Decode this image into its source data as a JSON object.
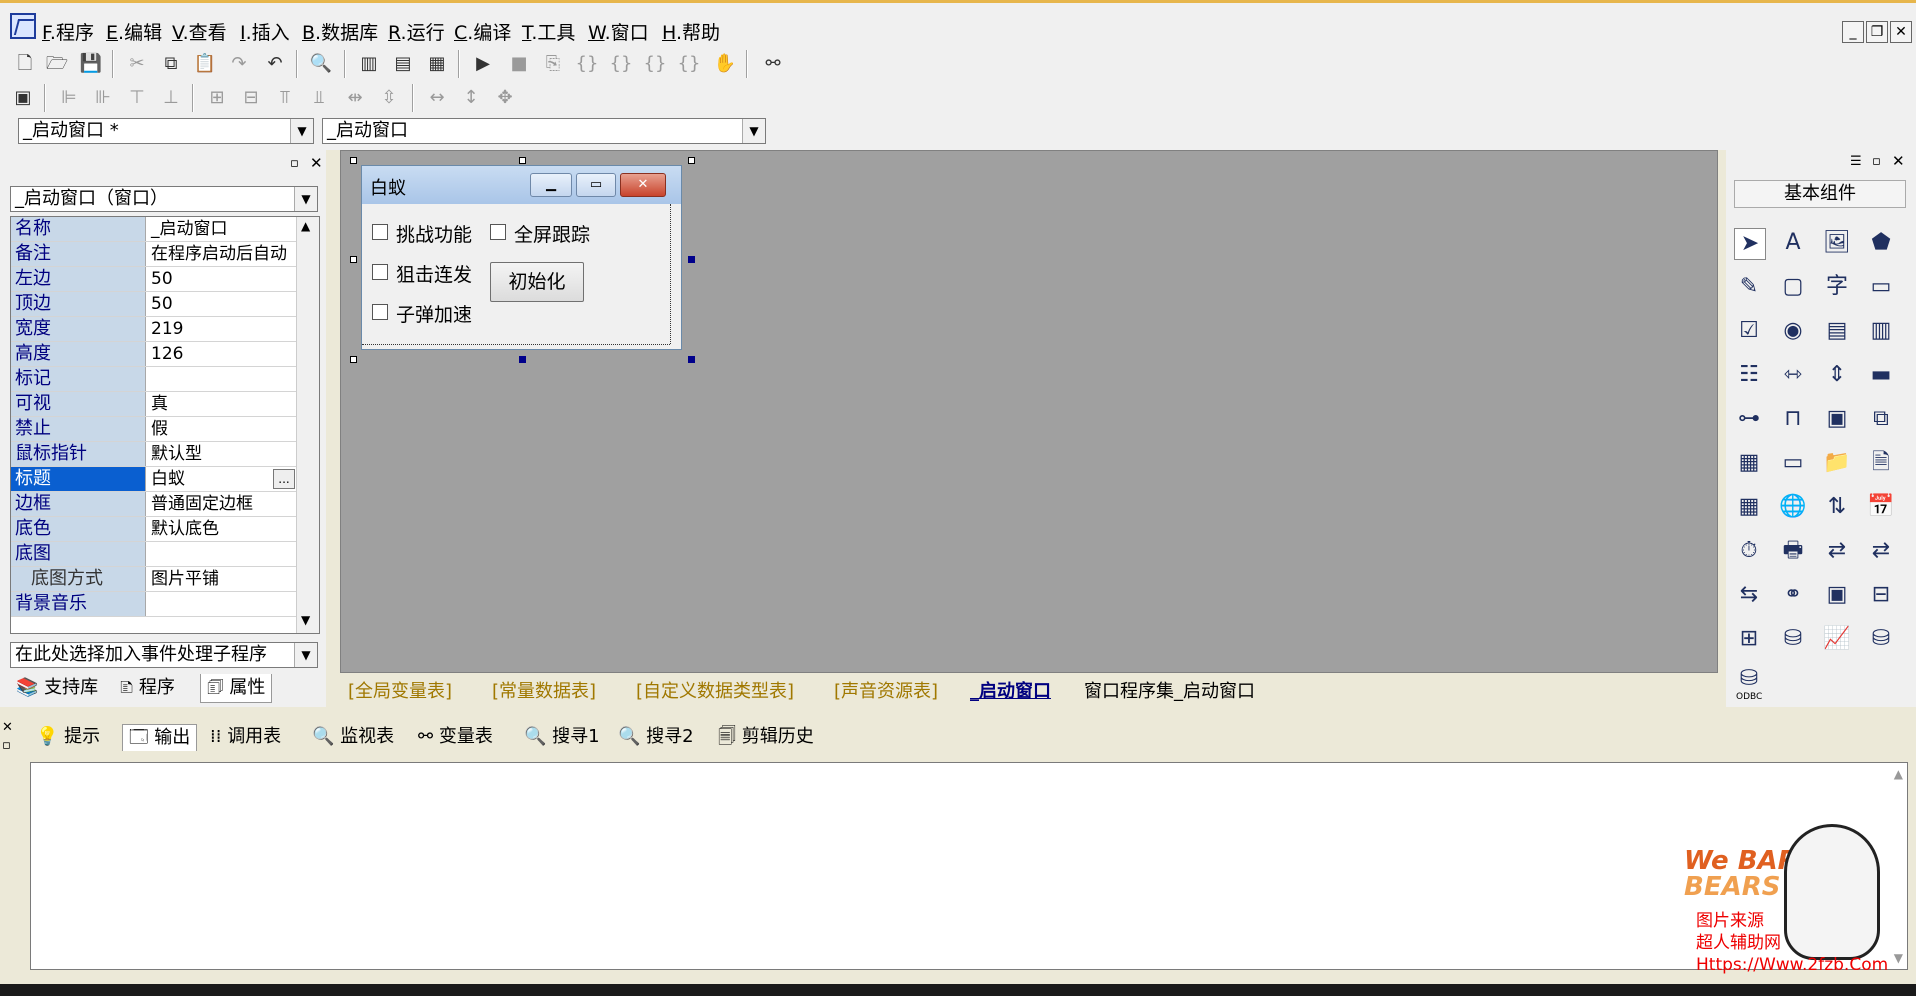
{
  "menu": [
    {
      "key": "F",
      "label": "程序"
    },
    {
      "key": "E",
      "label": "编辑"
    },
    {
      "key": "V",
      "label": "查看"
    },
    {
      "key": "I",
      "label": "插入"
    },
    {
      "key": "B",
      "label": "数据库"
    },
    {
      "key": "R",
      "label": "运行"
    },
    {
      "key": "C",
      "label": "编译"
    },
    {
      "key": "T",
      "label": "工具"
    },
    {
      "key": "W",
      "label": "窗口"
    },
    {
      "key": "H",
      "label": "帮助"
    }
  ],
  "combo": {
    "left_value": "_启动窗口 *",
    "right_value": "_启动窗口"
  },
  "props": {
    "object_combo": "_启动窗口（窗口）",
    "rows": [
      {
        "name": "名称",
        "value": "_启动窗口"
      },
      {
        "name": "备注",
        "value": "在程序启动后自动"
      },
      {
        "name": "左边",
        "value": "50"
      },
      {
        "name": "顶边",
        "value": "50"
      },
      {
        "name": "宽度",
        "value": "219"
      },
      {
        "name": "高度",
        "value": "126"
      },
      {
        "name": "标记",
        "value": ""
      },
      {
        "name": "可视",
        "value": "真"
      },
      {
        "name": "禁止",
        "value": "假"
      },
      {
        "name": "鼠标指针",
        "value": "默认型"
      },
      {
        "name": "标题",
        "value": "白蚁"
      },
      {
        "name": "边框",
        "value": "普通固定边框"
      },
      {
        "name": "底色",
        "value": "默认底色"
      },
      {
        "name": "底图",
        "value": ""
      },
      {
        "name": "底图方式",
        "value": "图片平铺"
      },
      {
        "name": "背景音乐",
        "value": ""
      }
    ],
    "event_combo": "在此处选择加入事件处理子程序",
    "more_button": "..."
  },
  "left_tabs": [
    "支持库",
    "程序",
    "属性"
  ],
  "form": {
    "title": "白蚁",
    "checkboxes": [
      "挑战功能",
      "全屏跟踪",
      "狙击连发",
      "子弹加速"
    ],
    "button": "初始化"
  },
  "doc_tabs": [
    "[全局变量表]",
    "[常量数据表]",
    "[自定义数据类型表]",
    "[声音资源表]",
    "_启动窗口",
    "窗口程序集_启动窗口"
  ],
  "palette": {
    "header": "基本组件",
    "odbc_label": "ODBC"
  },
  "output_tabs": [
    "提示",
    "输出",
    "调用表",
    "监视表",
    "变量表",
    "搜寻1",
    "搜寻2",
    "剪辑历史"
  ],
  "watermark": {
    "brand_top": "We BARE",
    "brand_bottom": "BEARS",
    "line1": "图片来源",
    "line2": "超人辅助网",
    "line3": "Https://Www.2fzb.Com"
  },
  "colors": {
    "selection": "#0a5fd0",
    "design_bg": "#a0a0a0",
    "tab_gold": "#a07800"
  }
}
